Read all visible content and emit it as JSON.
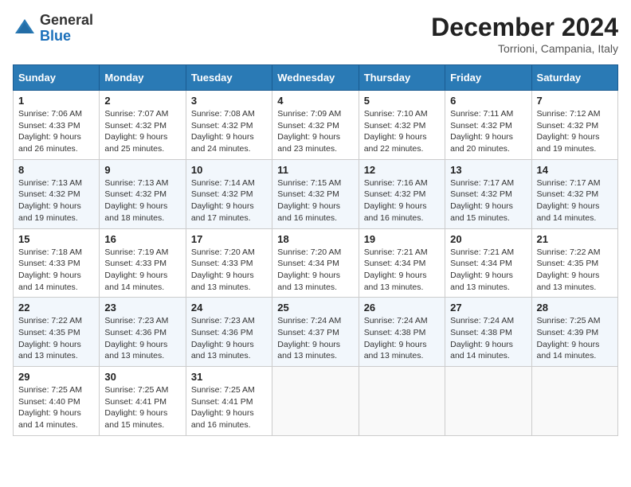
{
  "header": {
    "logo_general": "General",
    "logo_blue": "Blue",
    "month_title": "December 2024",
    "location": "Torrioni, Campania, Italy"
  },
  "days_of_week": [
    "Sunday",
    "Monday",
    "Tuesday",
    "Wednesday",
    "Thursday",
    "Friday",
    "Saturday"
  ],
  "weeks": [
    [
      {
        "day": 1,
        "sunrise": "7:06 AM",
        "sunset": "4:33 PM",
        "daylight": "9 hours and 26 minutes."
      },
      {
        "day": 2,
        "sunrise": "7:07 AM",
        "sunset": "4:32 PM",
        "daylight": "9 hours and 25 minutes."
      },
      {
        "day": 3,
        "sunrise": "7:08 AM",
        "sunset": "4:32 PM",
        "daylight": "9 hours and 24 minutes."
      },
      {
        "day": 4,
        "sunrise": "7:09 AM",
        "sunset": "4:32 PM",
        "daylight": "9 hours and 23 minutes."
      },
      {
        "day": 5,
        "sunrise": "7:10 AM",
        "sunset": "4:32 PM",
        "daylight": "9 hours and 22 minutes."
      },
      {
        "day": 6,
        "sunrise": "7:11 AM",
        "sunset": "4:32 PM",
        "daylight": "9 hours and 20 minutes."
      },
      {
        "day": 7,
        "sunrise": "7:12 AM",
        "sunset": "4:32 PM",
        "daylight": "9 hours and 19 minutes."
      }
    ],
    [
      {
        "day": 8,
        "sunrise": "7:13 AM",
        "sunset": "4:32 PM",
        "daylight": "9 hours and 19 minutes."
      },
      {
        "day": 9,
        "sunrise": "7:13 AM",
        "sunset": "4:32 PM",
        "daylight": "9 hours and 18 minutes."
      },
      {
        "day": 10,
        "sunrise": "7:14 AM",
        "sunset": "4:32 PM",
        "daylight": "9 hours and 17 minutes."
      },
      {
        "day": 11,
        "sunrise": "7:15 AM",
        "sunset": "4:32 PM",
        "daylight": "9 hours and 16 minutes."
      },
      {
        "day": 12,
        "sunrise": "7:16 AM",
        "sunset": "4:32 PM",
        "daylight": "9 hours and 16 minutes."
      },
      {
        "day": 13,
        "sunrise": "7:17 AM",
        "sunset": "4:32 PM",
        "daylight": "9 hours and 15 minutes."
      },
      {
        "day": 14,
        "sunrise": "7:17 AM",
        "sunset": "4:32 PM",
        "daylight": "9 hours and 14 minutes."
      }
    ],
    [
      {
        "day": 15,
        "sunrise": "7:18 AM",
        "sunset": "4:33 PM",
        "daylight": "9 hours and 14 minutes."
      },
      {
        "day": 16,
        "sunrise": "7:19 AM",
        "sunset": "4:33 PM",
        "daylight": "9 hours and 14 minutes."
      },
      {
        "day": 17,
        "sunrise": "7:20 AM",
        "sunset": "4:33 PM",
        "daylight": "9 hours and 13 minutes."
      },
      {
        "day": 18,
        "sunrise": "7:20 AM",
        "sunset": "4:34 PM",
        "daylight": "9 hours and 13 minutes."
      },
      {
        "day": 19,
        "sunrise": "7:21 AM",
        "sunset": "4:34 PM",
        "daylight": "9 hours and 13 minutes."
      },
      {
        "day": 20,
        "sunrise": "7:21 AM",
        "sunset": "4:34 PM",
        "daylight": "9 hours and 13 minutes."
      },
      {
        "day": 21,
        "sunrise": "7:22 AM",
        "sunset": "4:35 PM",
        "daylight": "9 hours and 13 minutes."
      }
    ],
    [
      {
        "day": 22,
        "sunrise": "7:22 AM",
        "sunset": "4:35 PM",
        "daylight": "9 hours and 13 minutes."
      },
      {
        "day": 23,
        "sunrise": "7:23 AM",
        "sunset": "4:36 PM",
        "daylight": "9 hours and 13 minutes."
      },
      {
        "day": 24,
        "sunrise": "7:23 AM",
        "sunset": "4:36 PM",
        "daylight": "9 hours and 13 minutes."
      },
      {
        "day": 25,
        "sunrise": "7:24 AM",
        "sunset": "4:37 PM",
        "daylight": "9 hours and 13 minutes."
      },
      {
        "day": 26,
        "sunrise": "7:24 AM",
        "sunset": "4:38 PM",
        "daylight": "9 hours and 13 minutes."
      },
      {
        "day": 27,
        "sunrise": "7:24 AM",
        "sunset": "4:38 PM",
        "daylight": "9 hours and 14 minutes."
      },
      {
        "day": 28,
        "sunrise": "7:25 AM",
        "sunset": "4:39 PM",
        "daylight": "9 hours and 14 minutes."
      }
    ],
    [
      {
        "day": 29,
        "sunrise": "7:25 AM",
        "sunset": "4:40 PM",
        "daylight": "9 hours and 14 minutes."
      },
      {
        "day": 30,
        "sunrise": "7:25 AM",
        "sunset": "4:41 PM",
        "daylight": "9 hours and 15 minutes."
      },
      {
        "day": 31,
        "sunrise": "7:25 AM",
        "sunset": "4:41 PM",
        "daylight": "9 hours and 16 minutes."
      },
      null,
      null,
      null,
      null
    ]
  ]
}
